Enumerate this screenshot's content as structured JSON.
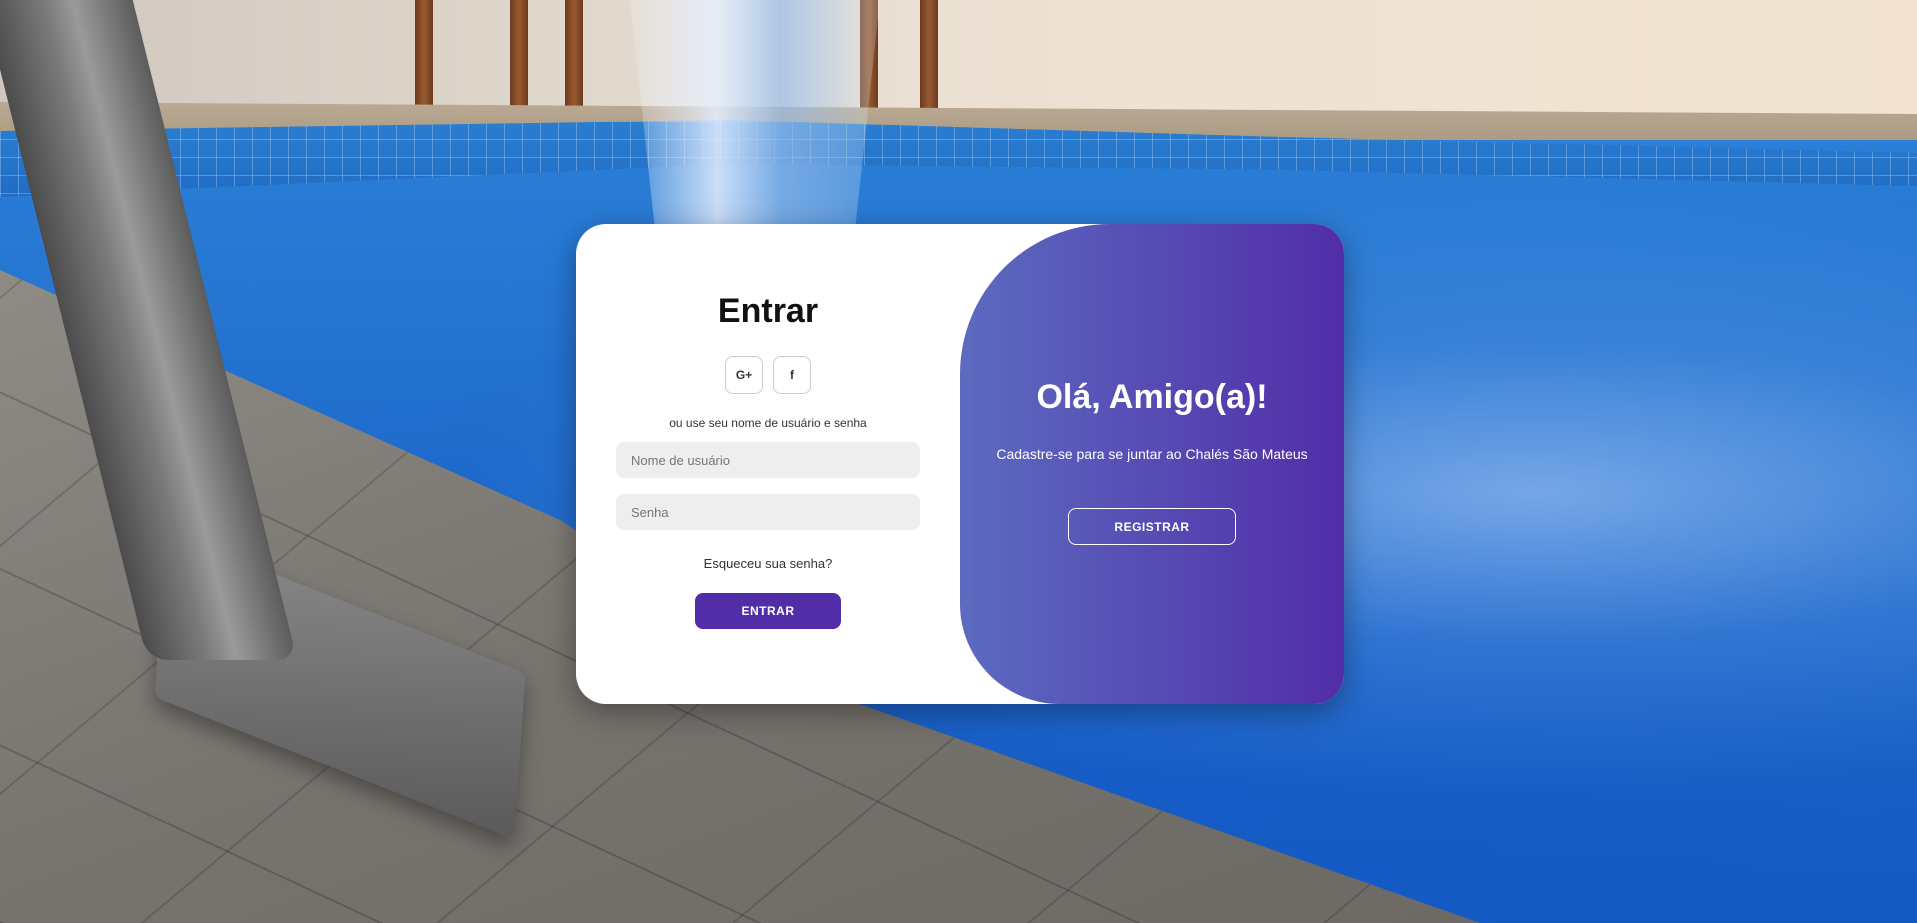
{
  "background": {
    "description_icon": "pool-background-image"
  },
  "login": {
    "title": "Entrar",
    "social": [
      {
        "label": "G+",
        "icon": "google-plus-icon"
      },
      {
        "label": "f",
        "icon": "facebook-icon"
      }
    ],
    "divider_text": "ou use seu nome de usuário e senha",
    "username_placeholder": "Nome de usuário",
    "password_placeholder": "Senha",
    "forgot_password": "Esqueceu sua senha?",
    "submit_label": "ENTRAR"
  },
  "toggle": {
    "title": "Olá, Amigo(a)!",
    "text": "Cadastre-se para se juntar ao Chalés São Mateus",
    "register_label": "REGISTRAR"
  },
  "colors": {
    "primary": "#512da8",
    "gradient_start": "#5c6bc0",
    "gradient_end": "#512da8",
    "card": "#ffffff",
    "input_bg": "#eeeeee"
  }
}
